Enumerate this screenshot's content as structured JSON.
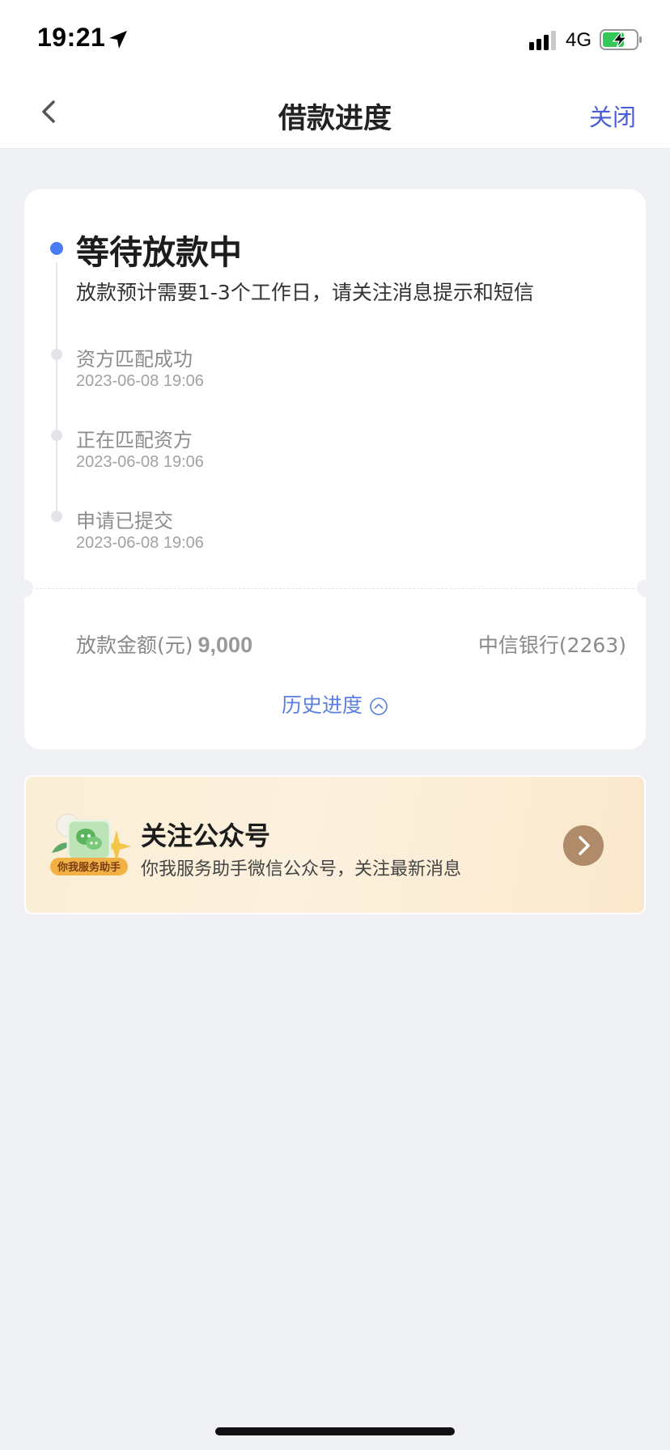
{
  "status_bar": {
    "time": "19:21",
    "network": "4G"
  },
  "nav": {
    "title": "借款进度",
    "close_label": "关闭"
  },
  "progress": {
    "current": {
      "title": "等待放款中",
      "desc": "放款预计需要1-3个工作日，请关注消息提示和短信"
    },
    "steps": [
      {
        "title": "资方匹配成功",
        "time": "2023-06-08 19:06"
      },
      {
        "title": "正在匹配资方",
        "time": "2023-06-08 19:06"
      },
      {
        "title": "申请已提交",
        "time": "2023-06-08 19:06"
      }
    ],
    "amount_label": "放款金额(元)",
    "amount_value": "9,000",
    "bank": "中信银行(2263)",
    "history_label": "历史进度"
  },
  "banner": {
    "badge": "你我服务助手",
    "title": "关注公众号",
    "desc": "你我服务助手微信公众号，关注最新消息"
  },
  "colors": {
    "accent": "#4a5cd8",
    "active_dot": "#4a7cf5",
    "history_link": "#5b7fe0",
    "banner_arrow": "#b08b6a"
  }
}
